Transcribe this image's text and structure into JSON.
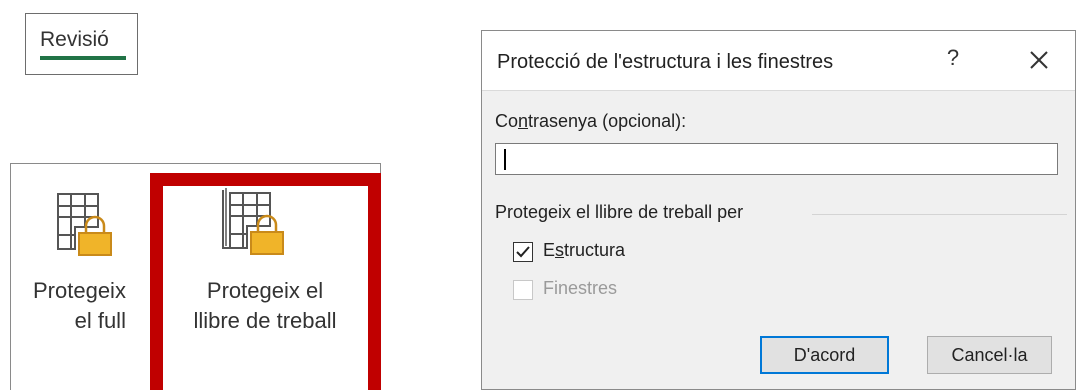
{
  "ribbon": {
    "tab_label": "Revisió",
    "protect_sheet": {
      "line1": "Protegeix",
      "line2": "el full"
    },
    "protect_workbook": {
      "line1": "Protegeix el",
      "line2": "llibre de treball"
    }
  },
  "dialog": {
    "title": "Protecció de l'estructura i les finestres",
    "help_label": "?",
    "password_label_prefix": "Co",
    "password_label_access": "n",
    "password_label_suffix": "trasenya (opcional):",
    "password_value": "",
    "group_label": "Protegeix el llibre de treball per",
    "structure": {
      "prefix": "E",
      "access": "s",
      "suffix": "tructura",
      "checked": true
    },
    "windows": {
      "label": "Finestres",
      "checked": false,
      "disabled": true
    },
    "ok_label": "D'acord",
    "cancel_label": "Cancel·la"
  },
  "colors": {
    "accent_green": "#217346",
    "highlight_red": "#c00000",
    "focus_blue": "#0078d7",
    "lock_gold": "#e8a317"
  }
}
